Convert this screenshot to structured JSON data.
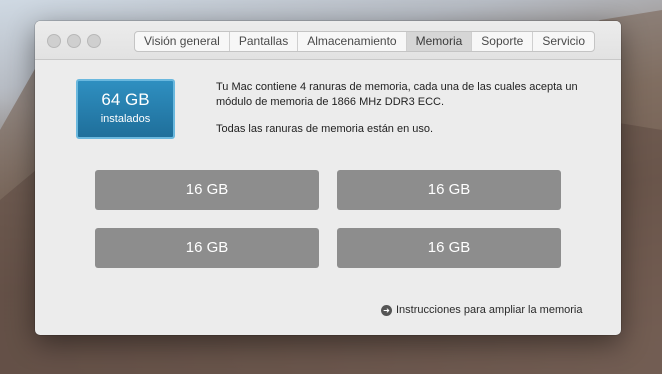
{
  "tabs": [
    {
      "label": "Visión general"
    },
    {
      "label": "Pantallas"
    },
    {
      "label": "Almacenamiento"
    },
    {
      "label": "Memoria"
    },
    {
      "label": "Soporte"
    },
    {
      "label": "Servicio"
    }
  ],
  "active_tab": "Memoria",
  "memory": {
    "installed_size": "64 GB",
    "installed_label": "instalados",
    "description_1": "Tu Mac contiene 4 ranuras de memoria, cada una de las cuales acepta un módulo de memoria de 1866 MHz DDR3 ECC.",
    "description_2": "Todas las ranuras de memoria están en uso.",
    "slots": [
      "16 GB",
      "16 GB",
      "16 GB",
      "16 GB"
    ],
    "upgrade_link": "Instrucciones para ampliar la memoria"
  },
  "colors": {
    "badge": "#1f6f9b",
    "slot": "#8d8d8d"
  }
}
